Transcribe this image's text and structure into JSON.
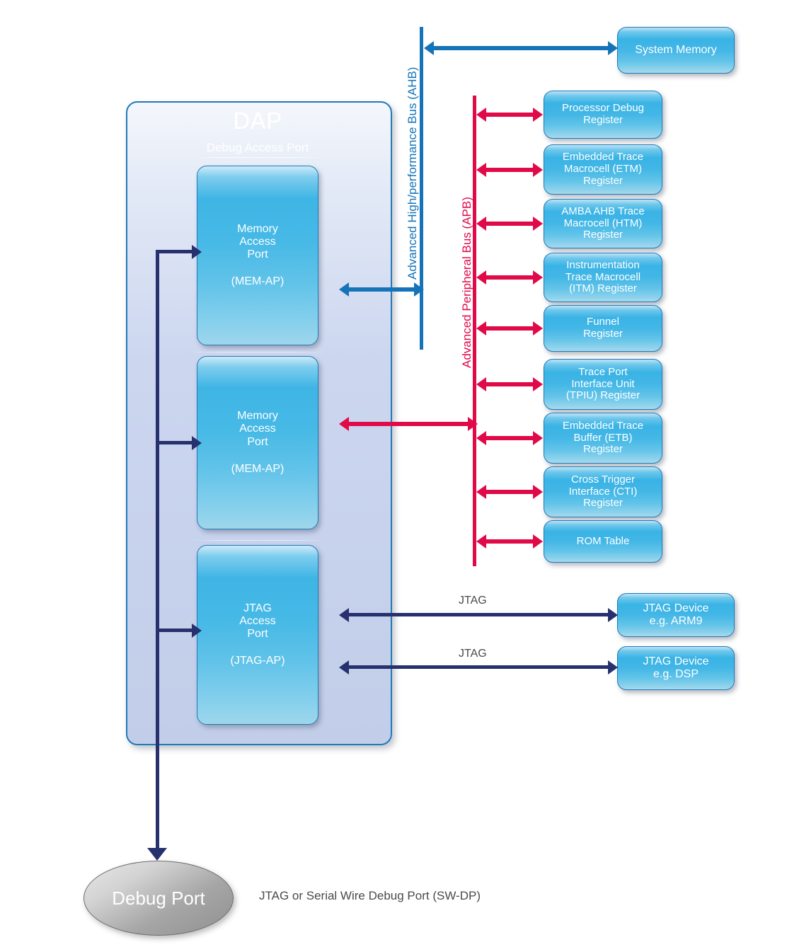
{
  "diagram": {
    "dap": {
      "title": "DAP",
      "subtitle": "Debug Access Port",
      "ports": [
        {
          "name": "Memory\nAccess\nPort",
          "line1a": "Memory",
          "line1b": "Access",
          "line1c": "Port",
          "line2": "(MEM-AP)"
        },
        {
          "name": "Memory Access Port 2",
          "line1a": "Memory",
          "line1b": "Access",
          "line1c": "Port",
          "line2": "(MEM-AP)"
        },
        {
          "name": "JTAG Access Port",
          "line1a": "JTAG",
          "line1b": "Access",
          "line1c": "Port",
          "line2": "(JTAG-AP)"
        }
      ]
    },
    "buses": {
      "ahb_label": "Advanced High/performance Bus (AHB)",
      "apb_label": "Advanced Peripheral Bus (APB)",
      "ahb_color": "#1574b8",
      "apb_color": "#e10a48"
    },
    "system_memory": "System Memory",
    "registers": [
      "Processor Debug\nRegister",
      "Embedded Trace\nMacrocell (ETM)\nRegister",
      "AMBA AHB Trace\nMacrocell (HTM)\nRegister",
      "Instrumentation\nTrace Macrocell\n(ITM) Register",
      "Funnel\nRegister",
      "Trace Port\nInterface Unit\n(TPIU) Register",
      "Embedded Trace\nBuffer (ETB)\nRegister",
      "Cross Trigger\nInterface (CTI)\nRegister",
      "ROM Table"
    ],
    "jtag": {
      "link_label_1": "JTAG",
      "link_label_2": "JTAG",
      "device_1": "JTAG Device\ne.g. ARM9",
      "device_2": "JTAG Device\ne.g. DSP"
    },
    "debug_port": {
      "label": "Debug Port",
      "caption": "JTAG or Serial Wire Debug Port (SW-DP)"
    }
  }
}
